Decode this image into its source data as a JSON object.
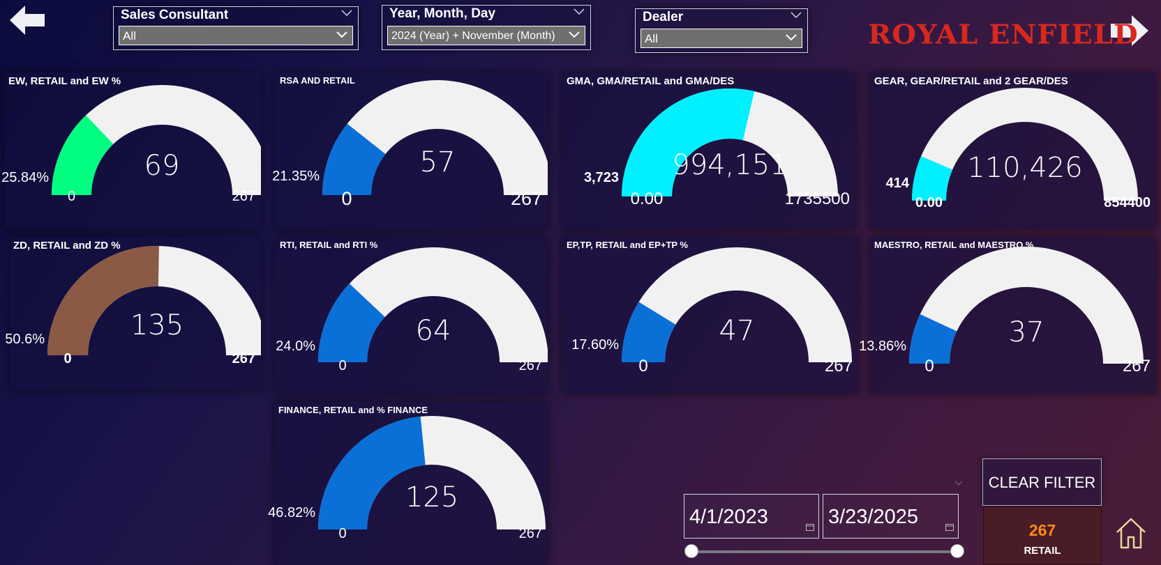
{
  "nav": {
    "back_icon": "arrow-left-icon",
    "forward_icon": "arrow-right-icon",
    "home_icon": "home-icon"
  },
  "slicers": {
    "sales_consultant": {
      "title": "Sales Consultant",
      "value": "All"
    },
    "date": {
      "title": "Year, Month, Day",
      "value": "2024 (Year) + November (Month)"
    },
    "dealer": {
      "title": "Dealer",
      "value": "All"
    }
  },
  "brand": {
    "text": "ROYAL ENFIELD",
    "color": "#d8281e"
  },
  "colors": {
    "track": "#f2f1f1",
    "green": "#00ff80",
    "blue": "#0a6fd6",
    "cyan": "#00f0ff",
    "brown": "#8b5a44",
    "retail_number": "#ff8a16"
  },
  "gauges": {
    "ew": {
      "title": "EW, RETAIL and EW %",
      "value": "69",
      "min": "0",
      "max": "267",
      "target": "25.84%",
      "fraction": 0.258,
      "color": "#00ff80"
    },
    "rsa": {
      "title": "RSA AND RETAIL",
      "value": "57",
      "min": "0",
      "max": "267",
      "target": "21.35%",
      "fraction": 0.213,
      "color": "#0a6fd6"
    },
    "gma": {
      "title": "GMA, GMA/RETAIL and GMA/DES",
      "value": "994,151",
      "min": "0.00",
      "max": "1735500",
      "target": "3,723",
      "fraction": 0.573,
      "color": "#00f0ff"
    },
    "gear": {
      "title": "GEAR, GEAR/RETAIL and 2 GEAR/DES",
      "value": "110,426",
      "min": "0.00",
      "max": "854400",
      "target": "414",
      "fraction": 0.129,
      "color": "#00f0ff"
    },
    "zd": {
      "title": "ZD, RETAIL and ZD %",
      "value": "135",
      "min": "0",
      "max": "267",
      "target": "50.6%",
      "fraction": 0.506,
      "color": "#8b5a44"
    },
    "rti": {
      "title": "RTI, RETAIL and RTI %",
      "value": "64",
      "min": "0",
      "max": "267",
      "target": "24.0%",
      "fraction": 0.24,
      "color": "#0a6fd6"
    },
    "eptp": {
      "title": "EP,TP, RETAIL and EP+TP %",
      "value": "47",
      "min": "0",
      "max": "267",
      "target": "17.60%",
      "fraction": 0.176,
      "color": "#0a6fd6"
    },
    "maestro": {
      "title": "MAESTRO, RETAIL and MAESTRO %",
      "value": "37",
      "min": "0",
      "max": "267",
      "target": "13.86%",
      "fraction": 0.139,
      "color": "#0a6fd6"
    },
    "finance": {
      "title": "FINANCE, RETAIL and % FINANCE",
      "value": "125",
      "min": "0",
      "max": "267",
      "target": "46.82%",
      "fraction": 0.468,
      "color": "#0a6fd6"
    }
  },
  "date_range": {
    "start": "4/1/2023",
    "end": "3/23/2025",
    "calendar_icon": "calendar-icon"
  },
  "buttons": {
    "clear_filter": "CLEAR FILTER"
  },
  "retail_card": {
    "number": "267",
    "label": "RETAIL"
  }
}
